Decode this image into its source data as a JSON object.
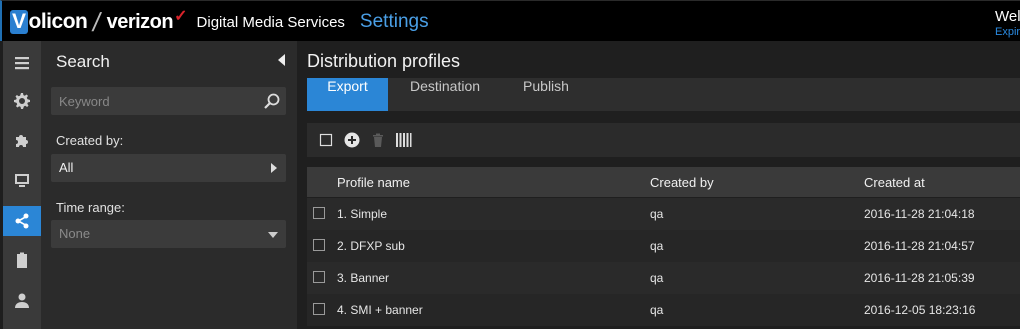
{
  "topbar": {
    "logo_v": "V",
    "logo_rest": "olicon",
    "slash": "/",
    "logo_verizon": "verizon",
    "verizon_check": "✓",
    "product": "Digital Media Services",
    "section": "Settings",
    "welcome": "Welc",
    "expire": "Expir"
  },
  "iconbar": {
    "items": [
      {
        "icon": "menu-icon"
      },
      {
        "icon": "gear-icon"
      },
      {
        "icon": "puzzle-icon"
      },
      {
        "icon": "monitor-icon"
      },
      {
        "icon": "share-icon",
        "active": true
      },
      {
        "icon": "clipboard-icon"
      },
      {
        "icon": "user-icon"
      }
    ]
  },
  "search_panel": {
    "title": "Search",
    "keyword_placeholder": "Keyword",
    "created_by_label": "Created by:",
    "created_by_value": "All",
    "time_range_label": "Time range:",
    "time_range_value": "None"
  },
  "main": {
    "title": "Distribution profiles",
    "tabs": [
      "Export",
      "Destination",
      "Publish"
    ],
    "active_tab": "Export",
    "columns": [
      "Profile name",
      "Created by",
      "Created at"
    ],
    "rows": [
      {
        "name": "1. Simple",
        "created_by": "qa",
        "created_at": "2016-11-28 21:04:18"
      },
      {
        "name": "2. DFXP sub",
        "created_by": "qa",
        "created_at": "2016-11-28 21:04:57"
      },
      {
        "name": "3. Banner",
        "created_by": "qa",
        "created_at": "2016-11-28 21:05:39"
      },
      {
        "name": "4. SMI + banner",
        "created_by": "qa",
        "created_at": "2016-12-05 18:23:16"
      }
    ]
  },
  "colors": {
    "accent": "#2b86d6",
    "link": "#4a9fe6",
    "brand_red": "#d8232a"
  }
}
